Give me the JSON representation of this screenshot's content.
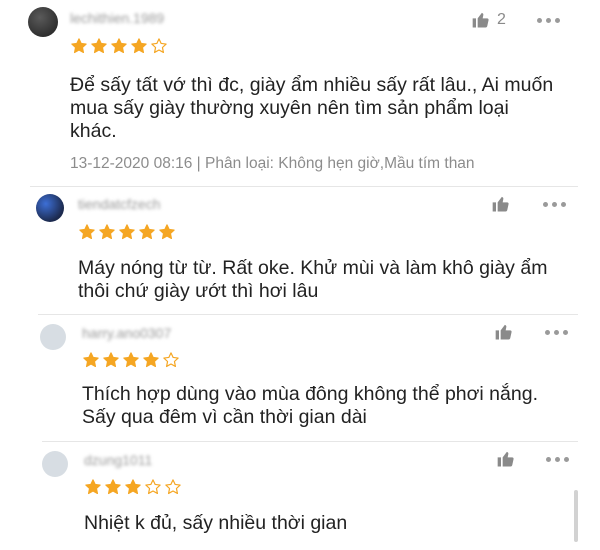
{
  "colors": {
    "star": "#f5a623",
    "text": "#222222",
    "meta": "#8c8c8c",
    "icon": "#8a8a8a"
  },
  "reviews": [
    {
      "username": "lechithien.1989",
      "rating": 4,
      "likes": "2",
      "lines": [
        "Để sấy tất vớ thì đc, giày ẩm nhiều sấy rất lâu., Ai muốn",
        "mua sấy giày thường xuyên nên tìm sản phẩm loại",
        "khác."
      ],
      "meta": "13-12-2020 08:16 | Phân loại: Không hẹn giờ,Mầu tím than"
    },
    {
      "username": "tiendatcfzech",
      "rating": 5,
      "likes": "",
      "lines": [
        "Máy nóng từ từ. Rất oke. Khử mùi và làm khô giày ẩm",
        "thôi chứ giày ướt thì hơi lâu"
      ],
      "meta": ""
    },
    {
      "username": "harry.ano0307",
      "rating": 4,
      "likes": "",
      "lines": [
        "Thích hợp dùng vào mùa đông không thể phơi nắng.",
        "Sấy qua đêm vì cần thời gian dài"
      ],
      "meta": ""
    },
    {
      "username": "dzung1011",
      "rating": 3,
      "likes": "",
      "lines": [
        "Nhiệt k đủ, sấy nhiều thời gian"
      ],
      "meta": ""
    }
  ]
}
